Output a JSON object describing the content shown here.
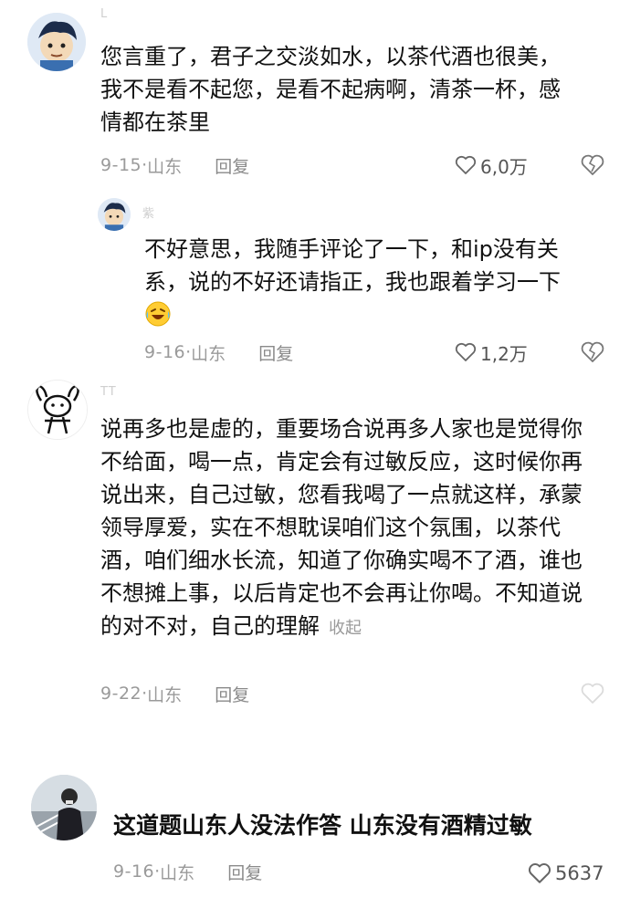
{
  "comments": [
    {
      "username": "L",
      "text": "您言重了，君子之交淡如水，以茶代酒也很美，我不是看不起您，是看不起病啊，清茶一杯，感情都在茶里",
      "date": "9-15",
      "location": "山东",
      "reply_label": "回复",
      "likes": "6,0万",
      "avatar_icon": "cartoon-boy-avatar-icon"
    },
    {
      "username": "紫",
      "text": "不好意思，我随手评论了一下，和ip没有关系，说的不好还请指正，我也跟着学习一下",
      "emoji": "laughing-crying-emoji-icon",
      "date": "9-16",
      "location": "山东",
      "reply_label": "回复",
      "likes": "1,2万",
      "avatar_icon": "cartoon-boy-avatar-icon"
    },
    {
      "username": "TT",
      "text": "说再多也是虚的，重要场合说再多人家也是觉得你不给面，喝一点，肯定会有过敏反应，这时候你再说出来，自己过敏，您看我喝了一点就这样，承蒙领导厚爱，实在不想耽误咱们这个氛围，以茶代酒，咱们细水长流，知道了你确实喝不了酒，谁也不想摊上事，以后肯定也不会再让你喝。不知道说的对不对，自己的理解",
      "collapse_label": "收起",
      "date": "9-22",
      "location": "山东",
      "reply_label": "回复",
      "avatar_icon": "doodle-dog-avatar-icon"
    },
    {
      "text": "这道题山东人没法作答 山东没有酒精过敏",
      "date": "9-16",
      "location": "山东",
      "reply_label": "回复",
      "likes": "5637",
      "avatar_icon": "photo-person-avatar-icon"
    }
  ],
  "colors": {
    "text": "#111111",
    "meta": "#9a9a9a",
    "background": "#ffffff"
  }
}
